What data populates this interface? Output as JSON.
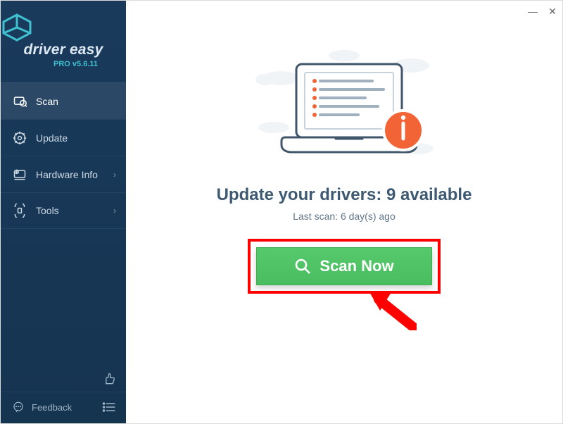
{
  "titlebar": {
    "minimize_glyph": "—",
    "close_glyph": "✕"
  },
  "brand": {
    "name": "driver easy",
    "version_prefix": "PRO v",
    "version": "5.6.11"
  },
  "sidebar": {
    "items": [
      {
        "label": "Scan",
        "icon": "scan-icon",
        "chevron": false,
        "active": true
      },
      {
        "label": "Update",
        "icon": "update-icon",
        "chevron": false,
        "active": false
      },
      {
        "label": "Hardware Info",
        "icon": "hardware-icon",
        "chevron": true,
        "active": false
      },
      {
        "label": "Tools",
        "icon": "tools-icon",
        "chevron": true,
        "active": false
      }
    ],
    "feedback_label": "Feedback"
  },
  "main": {
    "headline_prefix": "Update your drivers: ",
    "available_count": 9,
    "headline_suffix": " available",
    "lastscan_prefix": "Last scan: ",
    "lastscan_value": "6 day(s) ago",
    "scan_button_label": "Scan Now"
  }
}
